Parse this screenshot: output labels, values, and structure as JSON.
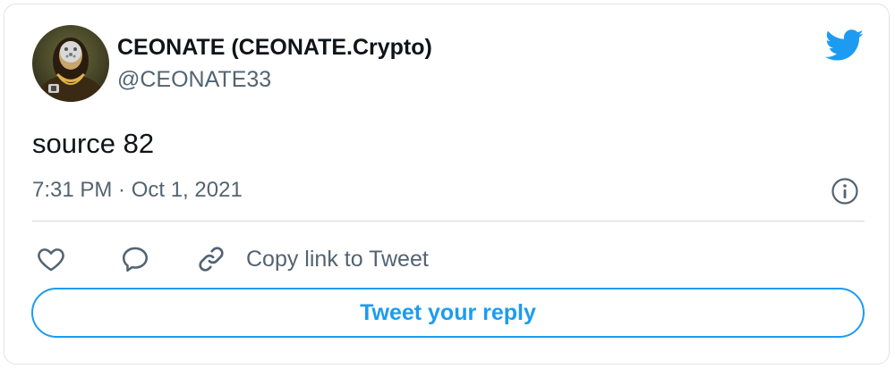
{
  "author": {
    "display_name": "CEONATE (CEONATE.Crypto)",
    "handle": "@CEONATE33",
    "avatar_icon": "masked-mona-lisa-avatar"
  },
  "tweet": {
    "text": "source 82",
    "timestamp": "7:31 PM · Oct 1, 2021"
  },
  "actions": {
    "like_icon": "heart-icon",
    "reply_icon": "speech-bubble-icon",
    "copy_link_icon": "link-icon",
    "copy_link_label": "Copy link to Tweet"
  },
  "reply_button": {
    "label": "Tweet your reply"
  },
  "colors": {
    "accent": "#1d9bf0",
    "text_primary": "#0f1419",
    "text_secondary": "#536471",
    "divider": "#cfd9de"
  }
}
